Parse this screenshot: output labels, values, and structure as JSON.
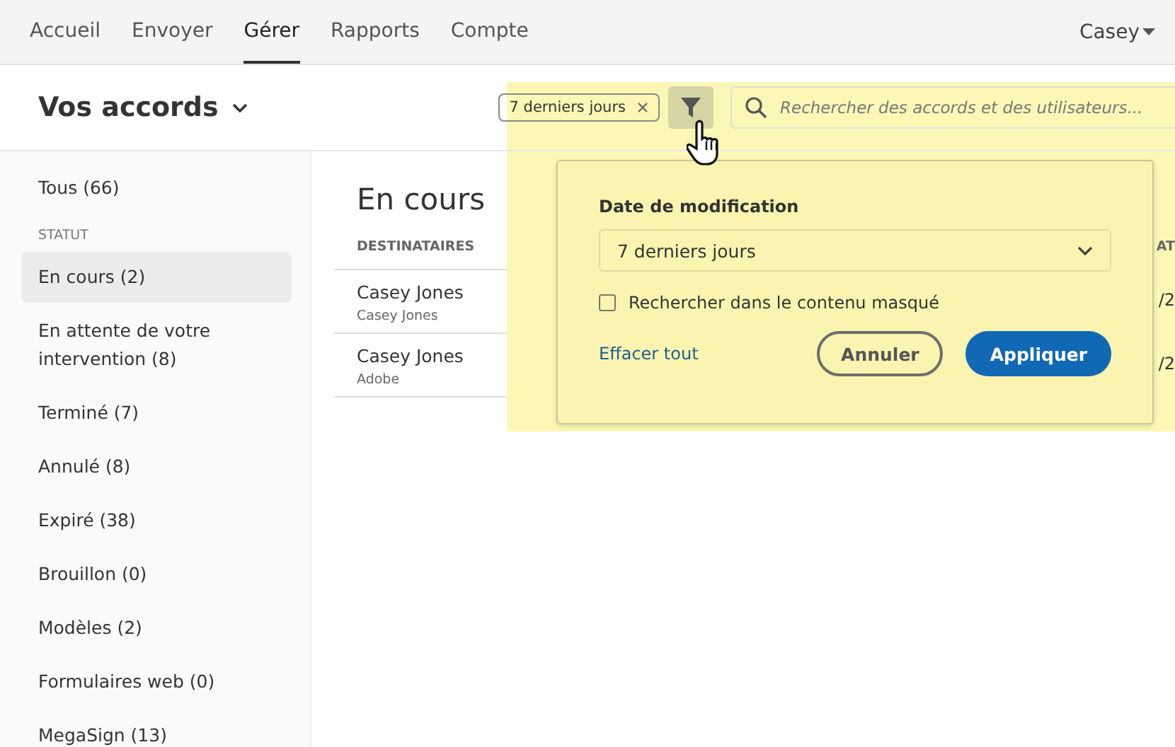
{
  "nav": {
    "tabs": [
      {
        "label": "Accueil",
        "selected": false
      },
      {
        "label": "Envoyer",
        "selected": false
      },
      {
        "label": "Gérer",
        "selected": true
      },
      {
        "label": "Rapports",
        "selected": false
      },
      {
        "label": "Compte",
        "selected": false
      }
    ],
    "user": "Casey"
  },
  "header": {
    "title": "Vos accords",
    "filter_chip": "7 derniers jours",
    "search": {
      "placeholder": "Rechercher des accords et des utilisateurs..."
    }
  },
  "sidebar": {
    "items": [
      {
        "kind": "item",
        "label": "Tous (66)",
        "selected": false
      },
      {
        "kind": "heading",
        "label": "STATUT"
      },
      {
        "kind": "item",
        "label": "En cours (2)",
        "selected": true
      },
      {
        "kind": "item",
        "label": "En attente de votre intervention (8)",
        "selected": false
      },
      {
        "kind": "item",
        "label": "Terminé (7)",
        "selected": false
      },
      {
        "kind": "item",
        "label": "Annulé (8)",
        "selected": false
      },
      {
        "kind": "item",
        "label": "Expiré (38)",
        "selected": false
      },
      {
        "kind": "item",
        "label": "Brouillon (0)",
        "selected": false
      },
      {
        "kind": "item",
        "label": "Modèles (2)",
        "selected": false
      },
      {
        "kind": "item",
        "label": "Formulaires web (0)",
        "selected": false
      },
      {
        "kind": "item",
        "label": "MegaSign (13)",
        "selected": false
      }
    ]
  },
  "main": {
    "title": "En cours",
    "table": {
      "columns": [
        "DESTINATAIRES",
        "AT"
      ],
      "rows": [
        {
          "name": "Casey Jones",
          "sub": "Casey Jones",
          "column_2": "/2"
        },
        {
          "name": "Casey Jones",
          "sub": "Adobe",
          "column_2": "/2"
        }
      ]
    }
  },
  "filter_popover": {
    "label": "Date de modification",
    "dropdown": "7 derniers jours",
    "checkbox": {
      "label": "Rechercher dans le contenu masqué",
      "checked": false
    },
    "clear": "Effacer tout",
    "buttons": [
      {
        "label": "Annuler",
        "kind": "secondary"
      },
      {
        "label": "Appliquer",
        "kind": "primary"
      }
    ]
  }
}
